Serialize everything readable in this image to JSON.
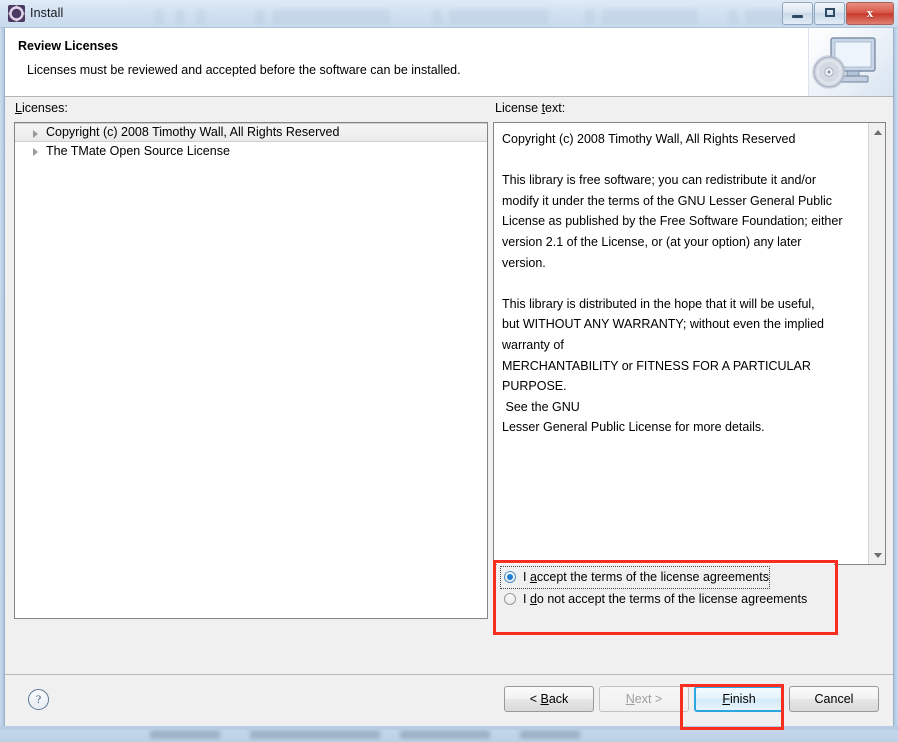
{
  "window": {
    "title": "Install",
    "icon": "install-gear-icon",
    "controls": {
      "minimize": "minimize-icon",
      "maximize": "maximize-icon",
      "close": "x"
    }
  },
  "header": {
    "title": "Review Licenses",
    "subtitle": "Licenses must be reviewed and accepted before the software can be installed.",
    "art_icon": "monitor-disc-icon"
  },
  "licenses_panel": {
    "label": "Licenses:",
    "label_mnemonic": "L",
    "items": [
      {
        "text": "Copyright (c) 2008 Timothy Wall, All Rights Reserved",
        "selected": true,
        "expandable": true
      },
      {
        "text": "The TMate Open Source License",
        "selected": false,
        "expandable": true
      }
    ]
  },
  "license_text_panel": {
    "label": "License text:",
    "label_mnemonic": "t",
    "body": "Copyright (c) 2008 Timothy Wall, All Rights Reserved\n\nThis library is free software; you can redistribute it and/or\nmodify it under the terms of the GNU Lesser General Public\nLicense as published by the Free Software Foundation; either\nversion 2.1 of the License, or (at your option) any later\nversion.\n\nThis library is distributed in the hope that it will be useful,\nbut WITHOUT ANY WARRANTY; without even the implied\nwarranty of\nMERCHANTABILITY or FITNESS FOR A PARTICULAR PURPOSE.\n See the GNU\nLesser General Public License for more details.",
    "scrollbar": {
      "up_arrow": "scroll-up-icon",
      "down_arrow": "scroll-down-icon"
    }
  },
  "acceptance": {
    "accept": {
      "label": "I accept the terms of the license agreements",
      "selected": true,
      "focused": true,
      "mnemonic": "a"
    },
    "decline": {
      "label": "I do not accept the terms of the license agreements",
      "selected": false,
      "focused": false,
      "mnemonic": "d"
    },
    "highlight_color": "#fa2d21"
  },
  "footer": {
    "help": "?",
    "buttons": [
      {
        "label": "< Back",
        "state": "enabled",
        "name": "back-button"
      },
      {
        "label": "Next >",
        "state": "disabled",
        "name": "next-button"
      },
      {
        "label": "Finish",
        "state": "default",
        "name": "finish-button",
        "highlighted": true
      },
      {
        "label": "Cancel",
        "state": "enabled",
        "name": "cancel-button"
      }
    ],
    "highlight_color": "#fa2d21",
    "focus_color": "#2ba6e0"
  }
}
